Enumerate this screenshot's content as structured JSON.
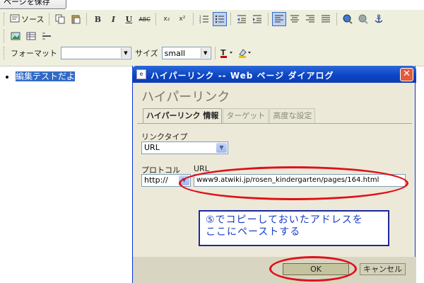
{
  "top": {
    "save_label": "ページを保存"
  },
  "toolbar": {
    "source_label": "ソース",
    "bold": "B",
    "italic": "I",
    "underline": "U",
    "strike": "ABC",
    "subscript": "x₂",
    "superscript": "x²",
    "format_label": "フォーマット",
    "format_value": "",
    "size_label": "サイズ",
    "size_value": "small"
  },
  "editor": {
    "list_item": "編集テストだよ"
  },
  "dialog": {
    "title": "ハイパーリンク -- Web ページ ダイアログ",
    "close": "✕",
    "heading": "ハイパーリンク",
    "tabs": [
      {
        "label": "ハイパーリンク 情報"
      },
      {
        "label": "ターゲット"
      },
      {
        "label": "高度な設定"
      }
    ],
    "link_type_label": "リンクタイプ",
    "link_type_value": "URL",
    "protocol_label": "プロトコル",
    "protocol_value": "http://",
    "url_label": "URL",
    "url_value": "www9.atwiki.jp/rosen_kindergarten/pages/164.html",
    "ok_label": "OK",
    "cancel_label": "キャンセル"
  },
  "annotation": {
    "line1": "⑤でコピーしておいたアドレスを",
    "line2": "ここにペーストする",
    "color": "#1a3cc4",
    "ellipse_color": "#e0101a"
  }
}
